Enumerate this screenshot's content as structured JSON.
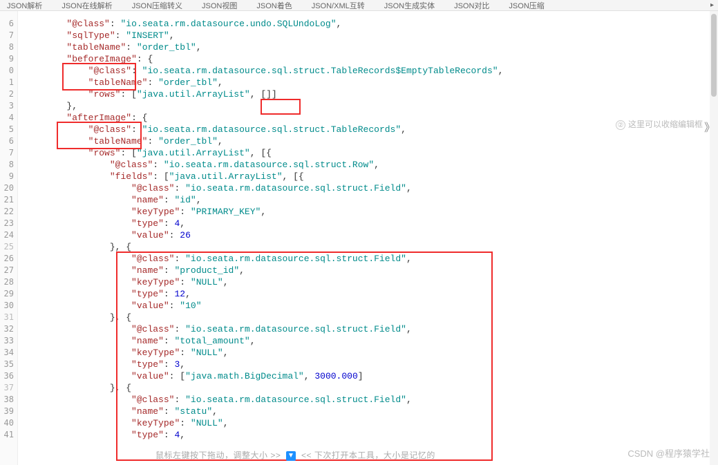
{
  "tabs": [
    "JSON解析",
    "JSON在线解析",
    "JSON压缩转义",
    "JSON视图",
    "JSON着色",
    "JSON/XML互转",
    "JSON生成实体",
    "JSON对比",
    "JSON压缩"
  ],
  "gutterLines": [
    "6",
    "7",
    "8",
    "9",
    "0",
    "1",
    "2",
    "3",
    "4",
    "5",
    "6",
    "7",
    "8",
    "9",
    "20",
    "21",
    "22",
    "23",
    "24",
    "25",
    "26",
    "27",
    "28",
    "29",
    "30",
    "31",
    "32",
    "33",
    "34",
    "35",
    "36",
    "37",
    "38",
    "39",
    "40",
    "41"
  ],
  "hintRight": "这里可以收缩编辑框",
  "hintCircle": "②",
  "bottomHintLeft": "鼠标左键按下拖动，调整大小 >>",
  "bottomHintRight": "<< 下次打开本工具，大小是记忆的",
  "bottomHintIcon": "▼",
  "watermark": "CSDN @程序猿学社",
  "code": {
    "l6": {
      "key": "@class",
      "val": "io.seata.rm.datasource.undo.SQLUndoLog"
    },
    "l7": {
      "key": "sqlType",
      "val": "INSERT"
    },
    "l8": {
      "key": "tableName",
      "val": "order_tbl"
    },
    "l9": {
      "key": "beforeImage"
    },
    "l10": {
      "key": "@class",
      "val": "io.seata.rm.datasource.sql.struct.TableRecords$EmptyTableRecords"
    },
    "l11": {
      "key": "tableName",
      "val": "order_tbl"
    },
    "l12": {
      "key": "rows",
      "val": "java.util.ArrayList",
      "extra": "[]"
    },
    "l14": {
      "key": "afterImage"
    },
    "l15": {
      "key": "@class",
      "val": "io.seata.rm.datasource.sql.struct.TableRecords"
    },
    "l16": {
      "key": "tableName",
      "val": "order_tbl"
    },
    "l17": {
      "key": "rows",
      "val": "java.util.ArrayList"
    },
    "l18": {
      "key": "@class",
      "val": "io.seata.rm.datasource.sql.struct.Row"
    },
    "l19": {
      "key": "fields",
      "val": "java.util.ArrayList"
    },
    "l20": {
      "key": "@class",
      "val": "io.seata.rm.datasource.sql.struct.Field"
    },
    "l21": {
      "key": "name",
      "val": "id"
    },
    "l22": {
      "key": "keyType",
      "val": "PRIMARY_KEY"
    },
    "l23": {
      "key": "type",
      "num": "4"
    },
    "l24": {
      "key": "value",
      "num": "26"
    },
    "l26": {
      "key": "@class",
      "val": "io.seata.rm.datasource.sql.struct.Field"
    },
    "l27": {
      "key": "name",
      "val": "product_id"
    },
    "l28": {
      "key": "keyType",
      "val": "NULL"
    },
    "l29": {
      "key": "type",
      "num": "12"
    },
    "l30": {
      "key": "value",
      "val": "10"
    },
    "l32": {
      "key": "@class",
      "val": "io.seata.rm.datasource.sql.struct.Field"
    },
    "l33": {
      "key": "name",
      "val": "total_amount"
    },
    "l34": {
      "key": "keyType",
      "val": "NULL"
    },
    "l35": {
      "key": "type",
      "num": "3"
    },
    "l36": {
      "key": "value",
      "val": "java.math.BigDecimal",
      "num": "3000.000"
    },
    "l38": {
      "key": "@class",
      "val": "io.seata.rm.datasource.sql.struct.Field"
    },
    "l39": {
      "key": "name",
      "val": "statu"
    },
    "l40": {
      "key": "keyType",
      "val": "NULL"
    },
    "l41": {
      "key": "type",
      "num": "4"
    }
  }
}
